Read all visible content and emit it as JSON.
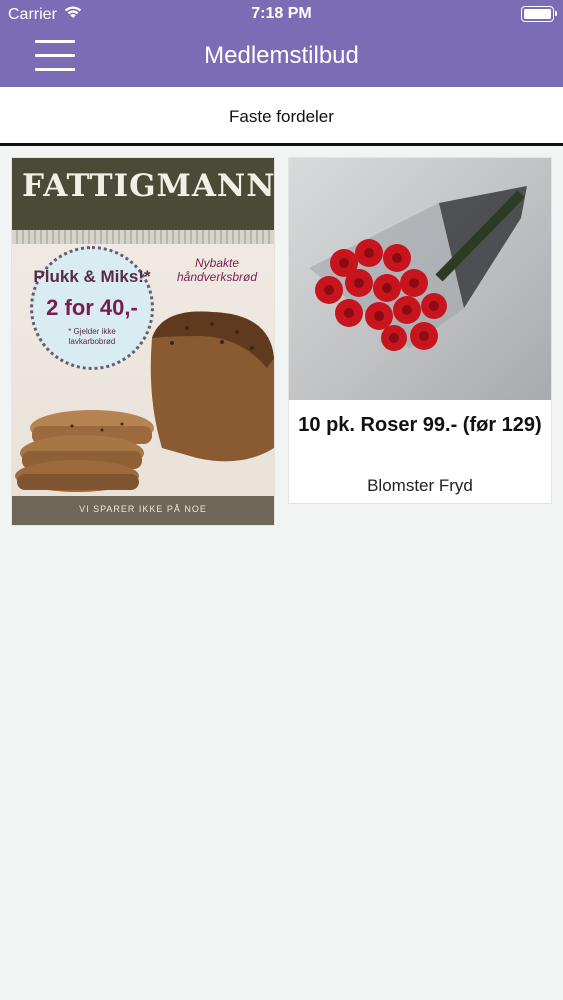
{
  "status_bar": {
    "carrier": "Carrier",
    "time": "7:18 PM",
    "icons": [
      "wifi-icon",
      "battery-icon"
    ]
  },
  "nav": {
    "title": "Medlemstilbud",
    "menu_icon": "hamburger-menu-icon"
  },
  "tab": {
    "label": "Faste fordeler"
  },
  "offers": [
    {
      "image": "fattigmann-bread-ad",
      "brand": "FATTIGMANN",
      "promo_line1": "Plukk & Miks!*",
      "promo_line2": "2 for 40,-",
      "promo_note": "* Gjelder ikke lavkarbobrød",
      "handwritten_note": "Nybakte håndverksbrød",
      "slogan": "VI SPARER IKKE PÅ NOE"
    },
    {
      "image": "red-roses-bouquet",
      "title": "10 pk. Roser 99.- (før 129)",
      "store": "Blomster Fryd"
    }
  ],
  "colors": {
    "header": "#7b6db5",
    "background": "#f2f3f3",
    "card": "#ffffff"
  }
}
